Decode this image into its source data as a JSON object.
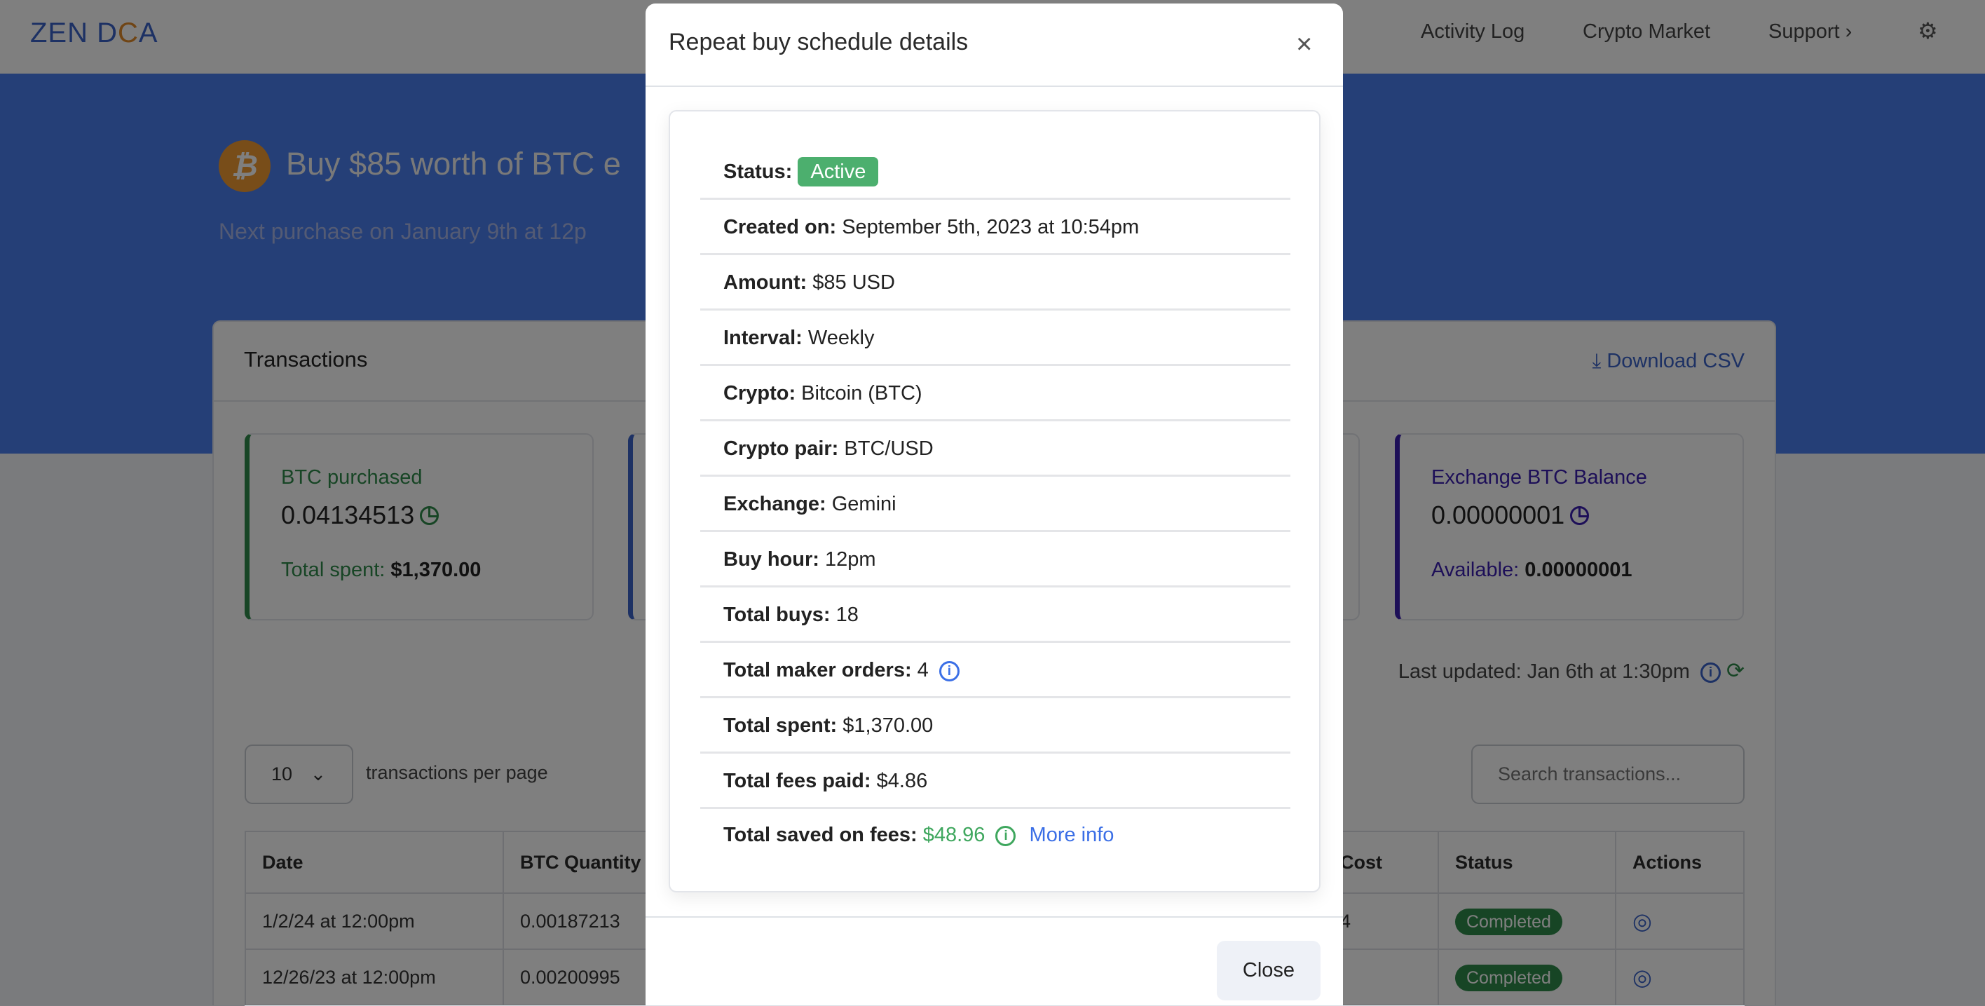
{
  "nav": {
    "logo": "ZEN DCA",
    "logo_parts": [
      "ZEN D",
      "C",
      "A"
    ],
    "links": [
      "Activity Log",
      "Crypto Market",
      "Support ›"
    ],
    "settings_icon": "gear-icon"
  },
  "hero": {
    "title": "Buy $85 worth of BTC e",
    "subtitle": "Next purchase on January 9th at 12p",
    "icon": "bitcoin-icon"
  },
  "transactions": {
    "title": "Transactions",
    "download": "Download CSV",
    "stats": [
      {
        "title": "BTC purchased",
        "value": "0.04134513",
        "sub_label": "Total spent:",
        "sub_value": "$1,370.00",
        "color": "#2f8a4a"
      },
      {
        "title": "Exchange BTC Balance",
        "value": "0.00000001",
        "sub_label": "Available:",
        "sub_value": "0.00000001",
        "color": "#3b1fb0"
      }
    ],
    "last_updated": "Last updated: Jan 6th at 1:30pm",
    "per_page": "10",
    "per_page_label": "transactions per page",
    "search_placeholder": "Search transactions...",
    "columns": [
      "Date",
      "BTC Quantity",
      "Cost",
      "Status",
      "Actions"
    ],
    "rows": [
      {
        "date": "1/2/24 at 12:00pm",
        "qty": "0.00187213",
        "cost": "4",
        "status": "Completed"
      },
      {
        "date": "12/26/23 at 12:00pm",
        "qty": "0.00200995",
        "cost": "",
        "status": "Completed"
      }
    ]
  },
  "modal": {
    "title": "Repeat buy schedule details",
    "close_icon": "×",
    "close_button": "Close",
    "status_label": "Status:",
    "status_value": "Active",
    "rows": [
      {
        "label": "Created on:",
        "value": "September 5th, 2023 at 10:54pm"
      },
      {
        "label": "Amount:",
        "value": "$85 USD"
      },
      {
        "label": "Interval:",
        "value": "Weekly"
      },
      {
        "label": "Crypto:",
        "value": "Bitcoin (BTC)"
      },
      {
        "label": "Crypto pair:",
        "value": "BTC/USD"
      },
      {
        "label": "Exchange:",
        "value": "Gemini"
      },
      {
        "label": "Buy hour:",
        "value": "12pm"
      },
      {
        "label": "Total buys:",
        "value": "18"
      },
      {
        "label": "Total maker orders:",
        "value": "4"
      },
      {
        "label": "Total spent:",
        "value": "$1,370.00"
      },
      {
        "label": "Total fees paid:",
        "value": "$4.86"
      }
    ],
    "saved_label": "Total saved on fees:",
    "saved_value": "$48.96",
    "more_info": "More info",
    "colors": {
      "active": "#4caf6e",
      "saved": "#3fa75e",
      "link": "#3b6fe6"
    }
  }
}
